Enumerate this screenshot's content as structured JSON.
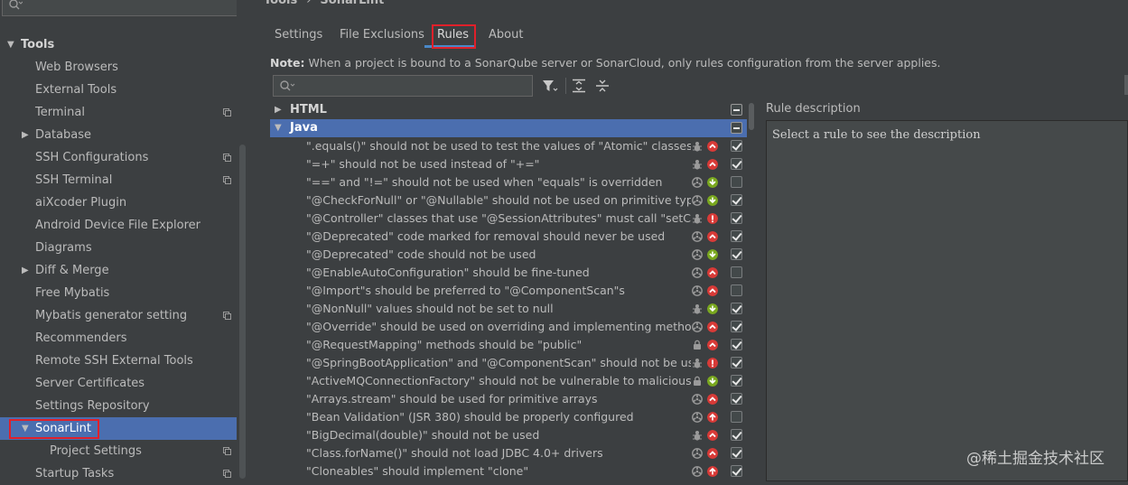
{
  "sidebar": {
    "items": [
      {
        "label": "Tools",
        "indent": 0,
        "expandable": true,
        "expanded": true,
        "bold": true,
        "copy": false
      },
      {
        "label": "Web Browsers",
        "indent": 1,
        "copy": false
      },
      {
        "label": "External Tools",
        "indent": 1,
        "copy": false
      },
      {
        "label": "Terminal",
        "indent": 1,
        "copy": true
      },
      {
        "label": "Database",
        "indent": 1,
        "expandable": true,
        "expanded": false,
        "copy": false
      },
      {
        "label": "SSH Configurations",
        "indent": 1,
        "copy": true
      },
      {
        "label": "SSH Terminal",
        "indent": 1,
        "copy": true
      },
      {
        "label": "aiXcoder Plugin",
        "indent": 1,
        "copy": false
      },
      {
        "label": "Android Device File Explorer",
        "indent": 1,
        "copy": false
      },
      {
        "label": "Diagrams",
        "indent": 1,
        "copy": false
      },
      {
        "label": "Diff & Merge",
        "indent": 1,
        "expandable": true,
        "expanded": false,
        "copy": false
      },
      {
        "label": "Free Mybatis",
        "indent": 1,
        "copy": false
      },
      {
        "label": "Mybatis generator setting",
        "indent": 1,
        "copy": true
      },
      {
        "label": "Recommenders",
        "indent": 1,
        "copy": false
      },
      {
        "label": "Remote SSH External Tools",
        "indent": 1,
        "copy": false
      },
      {
        "label": "Server Certificates",
        "indent": 1,
        "copy": false
      },
      {
        "label": "Settings Repository",
        "indent": 1,
        "copy": false
      },
      {
        "label": "SonarLint",
        "indent": 1,
        "expandable": true,
        "expanded": true,
        "selected": true,
        "copy": false
      },
      {
        "label": "Project Settings",
        "indent": 2,
        "copy": true
      },
      {
        "label": "Startup Tasks",
        "indent": 1,
        "copy": true
      }
    ]
  },
  "breadcrumb": {
    "root": "Tools",
    "separator": "›",
    "current": "SonarLint"
  },
  "tabs": [
    {
      "label": "Settings"
    },
    {
      "label": "File Exclusions"
    },
    {
      "label": "Rules",
      "active": true
    },
    {
      "label": "About"
    }
  ],
  "note": {
    "bold": "Note:",
    "text": " When a project is bound to a SonarQube server or SonarCloud, only rules configuration from the server applies."
  },
  "rules": {
    "groups": [
      {
        "name": "HTML",
        "expanded": false
      },
      {
        "name": "Java",
        "expanded": true,
        "selected": true
      }
    ],
    "items": [
      {
        "name": "\".equals()\" should not be used to test the values of \"Atomic\" classes",
        "type": "bug",
        "severity": "major",
        "enabled": true
      },
      {
        "name": "\"=+\" should not be used instead of \"+=\"",
        "type": "bug",
        "severity": "major",
        "enabled": true
      },
      {
        "name": "\"==\" and \"!=\" should not be used when \"equals\" is overridden",
        "type": "code-smell",
        "severity": "minor",
        "enabled": false
      },
      {
        "name": "\"@CheckForNull\" or \"@Nullable\" should not be used on primitive types",
        "type": "code-smell",
        "severity": "minor",
        "enabled": true
      },
      {
        "name": "\"@Controller\" classes that use \"@SessionAttributes\" must call \"setComplete\"",
        "type": "bug",
        "severity": "critical",
        "enabled": true
      },
      {
        "name": "\"@Deprecated\" code marked for removal should never be used",
        "type": "code-smell",
        "severity": "major",
        "enabled": true
      },
      {
        "name": "\"@Deprecated\" code should not be used",
        "type": "code-smell",
        "severity": "minor",
        "enabled": true
      },
      {
        "name": "\"@EnableAutoConfiguration\" should be fine-tuned",
        "type": "code-smell",
        "severity": "major",
        "enabled": false
      },
      {
        "name": "\"@Import\"s should be preferred to \"@ComponentScan\"s",
        "type": "code-smell",
        "severity": "major",
        "enabled": false
      },
      {
        "name": "\"@NonNull\" values should not be set to null",
        "type": "bug",
        "severity": "minor",
        "enabled": true
      },
      {
        "name": "\"@Override\" should be used on overriding and implementing methods",
        "type": "code-smell",
        "severity": "major",
        "enabled": true
      },
      {
        "name": "\"@RequestMapping\" methods should be \"public\"",
        "type": "vulnerability",
        "severity": "major",
        "enabled": true
      },
      {
        "name": "\"@SpringBootApplication\" and \"@ComponentScan\" should not be used in the default package",
        "type": "bug",
        "severity": "critical",
        "enabled": true
      },
      {
        "name": "\"ActiveMQConnectionFactory\" should not be vulnerable to malicious code deserialization",
        "type": "vulnerability",
        "severity": "minor",
        "enabled": true
      },
      {
        "name": "\"Arrays.stream\" should be used for primitive arrays",
        "type": "code-smell",
        "severity": "major",
        "enabled": true
      },
      {
        "name": "\"Bean Validation\" (JSR 380) should be properly configured",
        "type": "code-smell",
        "severity": "blocker",
        "enabled": false
      },
      {
        "name": "\"BigDecimal(double)\" should not be used",
        "type": "bug",
        "severity": "major",
        "enabled": true
      },
      {
        "name": "\"Class.forName()\" should not load JDBC 4.0+ drivers",
        "type": "code-smell",
        "severity": "major",
        "enabled": true
      },
      {
        "name": "\"Cloneables\" should implement \"clone\"",
        "type": "code-smell",
        "severity": "blocker",
        "enabled": true
      }
    ]
  },
  "description": {
    "title": "Rule description",
    "placeholder": "Select a rule to see the description"
  },
  "watermark": "@稀土掘金技术社区",
  "colors": {
    "accent": "#4b6eaf",
    "highlight_box": "#e0202a",
    "severity_major": "#d83a37",
    "severity_critical": "#d83a37",
    "severity_minor": "#7aa81f",
    "severity_blocker": "#d83a37"
  }
}
